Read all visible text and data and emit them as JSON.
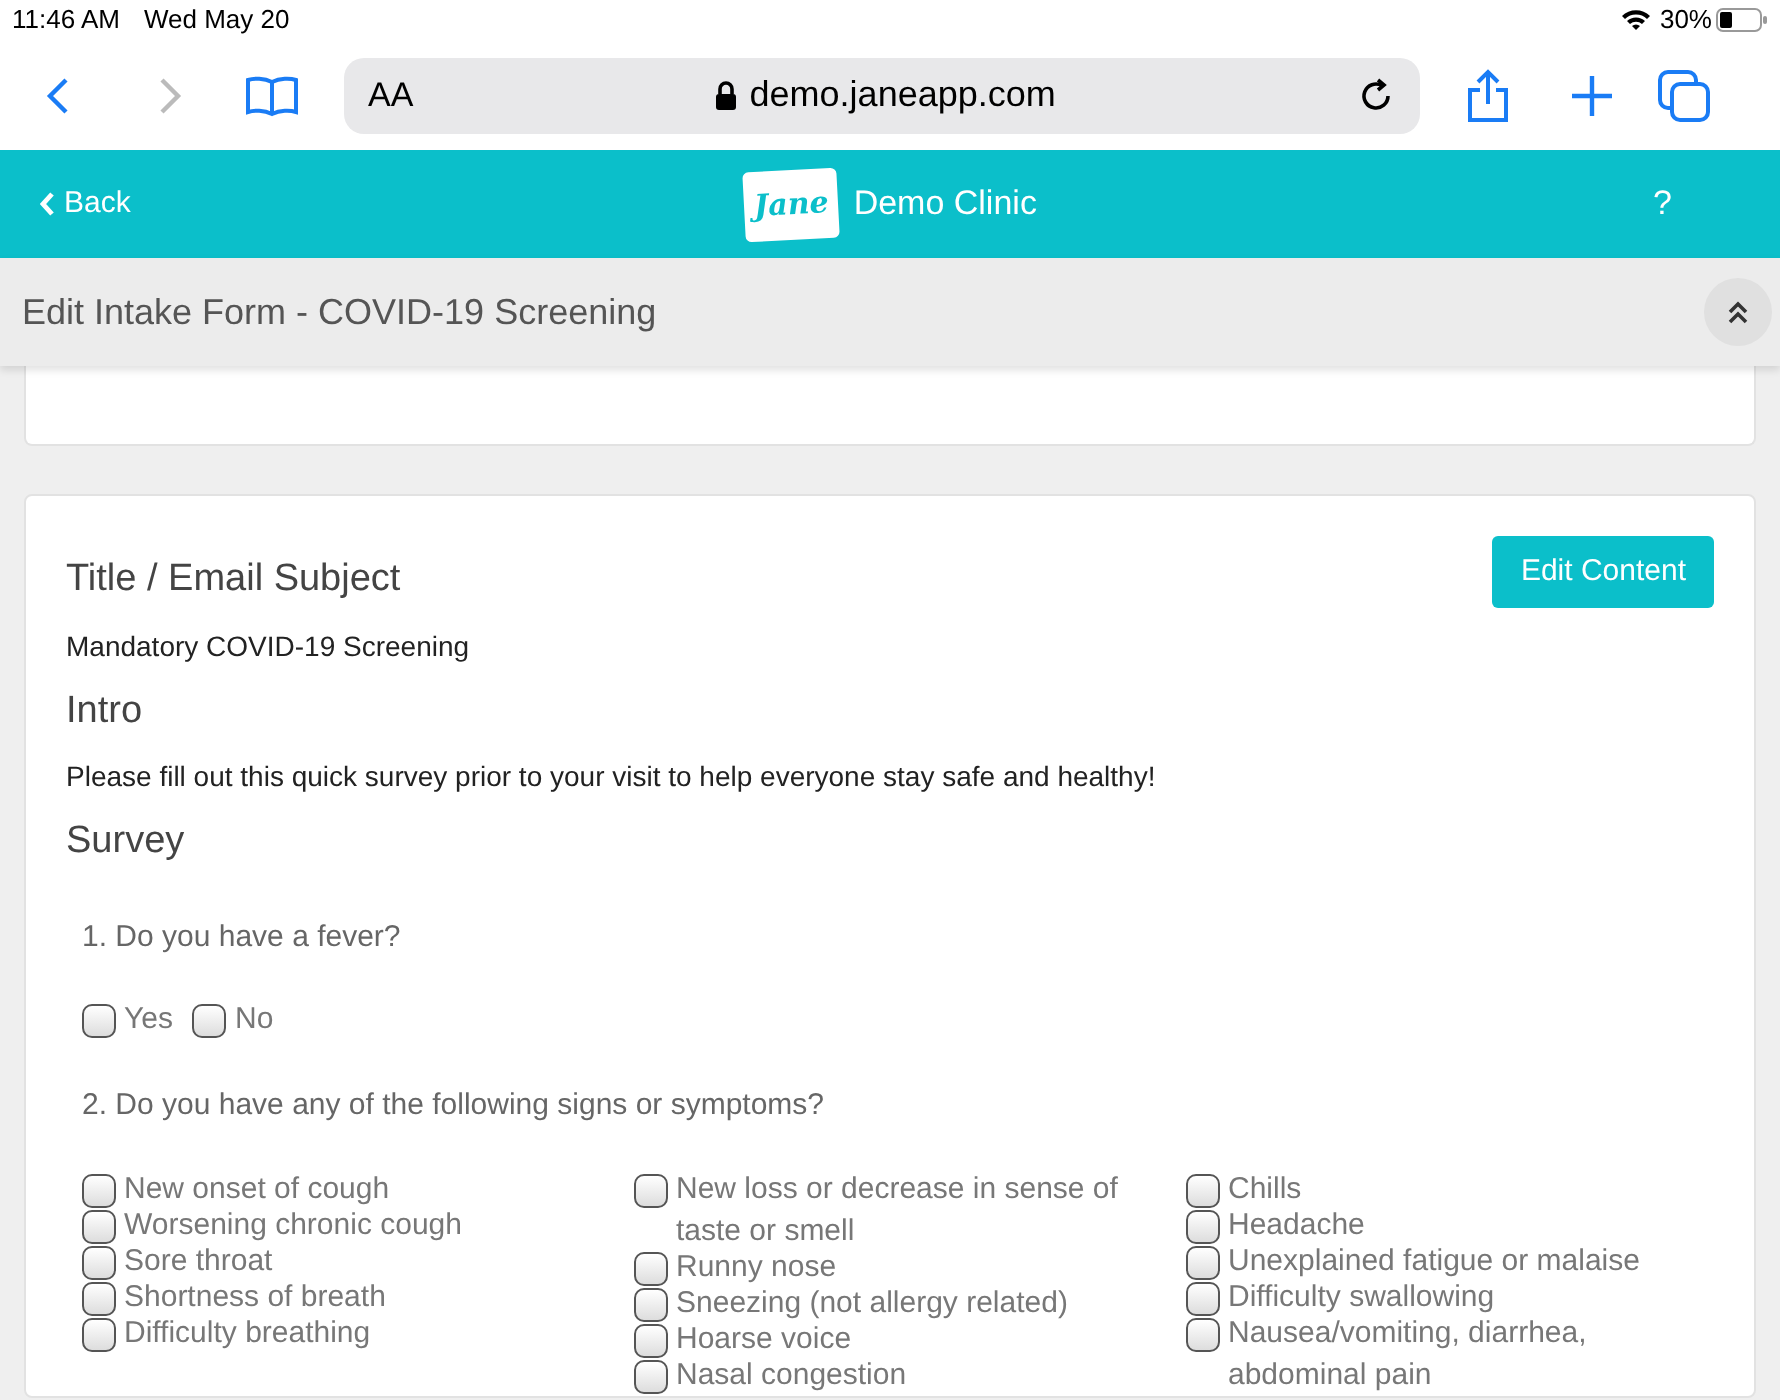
{
  "status_bar": {
    "time": "11:46 AM",
    "date": "Wed May 20",
    "battery": "30%"
  },
  "browser": {
    "text_size": "AA",
    "url": "demo.janeapp.com"
  },
  "app_header": {
    "back": "Back",
    "logo": "Jane",
    "clinic": "Demo Clinic",
    "help": "?"
  },
  "form_header": {
    "title": "Edit Intake Form - COVID-19 Screening"
  },
  "content": {
    "edit_button": "Edit Content",
    "sections": [
      {
        "kind": "heading",
        "text": "Title / Email Subject"
      },
      {
        "kind": "body",
        "text": "Mandatory COVID-19 Screening"
      },
      {
        "kind": "heading",
        "text": "Intro"
      },
      {
        "kind": "body",
        "text": "Please fill out this quick survey prior to your visit to help everyone stay safe and healthy!"
      },
      {
        "kind": "heading",
        "text": "Survey"
      }
    ],
    "questions": [
      {
        "text": "1. Do you have a fever?",
        "kind": "inline",
        "columns": [
          [
            {
              "label": "Yes",
              "checked": false
            },
            {
              "label": "No",
              "checked": false
            }
          ]
        ]
      },
      {
        "text": "2. Do you have any of the following signs or symptoms?",
        "kind": "columns",
        "columns": [
          [
            {
              "label": "New onset of cough",
              "checked": false
            },
            {
              "label": "Worsening chronic cough",
              "checked": false
            },
            {
              "label": "Sore throat",
              "checked": false
            },
            {
              "label": "Shortness of breath",
              "checked": false
            },
            {
              "label": "Difficulty breathing",
              "checked": false
            }
          ],
          [
            {
              "label": "New loss or decrease in sense of taste or smell",
              "checked": false
            },
            {
              "label": "Runny nose",
              "checked": false
            },
            {
              "label": "Sneezing (not allergy related)",
              "checked": false
            },
            {
              "label": "Hoarse voice",
              "checked": false
            },
            {
              "label": "Nasal congestion",
              "checked": false
            }
          ],
          [
            {
              "label": "Chills",
              "checked": false
            },
            {
              "label": "Headache",
              "checked": false
            },
            {
              "label": "Unexplained fatigue or malaise",
              "checked": false
            },
            {
              "label": "Difficulty swallowing",
              "checked": false
            },
            {
              "label": "Nausea/vomiting, diarrhea, abdominal pain",
              "checked": false
            }
          ]
        ]
      }
    ]
  }
}
